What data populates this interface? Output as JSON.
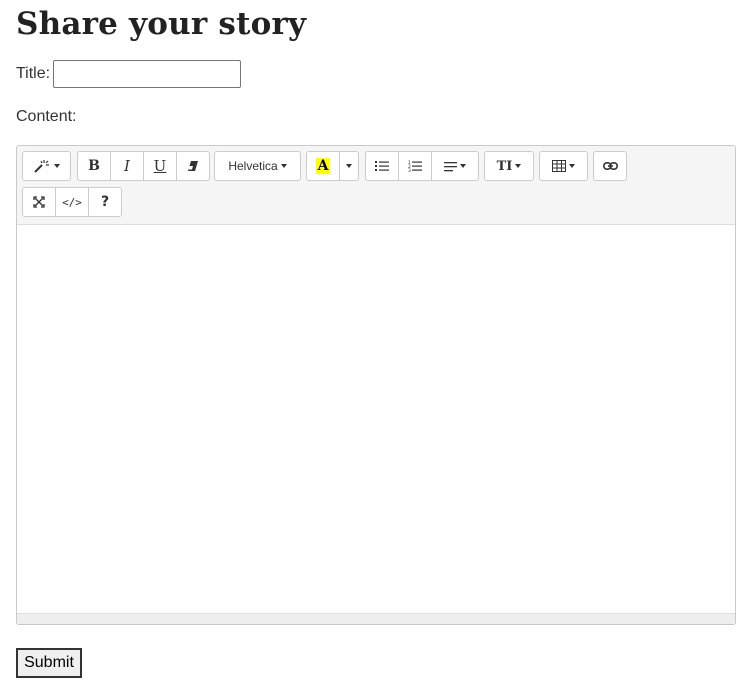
{
  "page": {
    "heading": "Share your story"
  },
  "form": {
    "title_label": "Title:",
    "title_value": "",
    "content_label": "Content:",
    "submit_label": "Submit"
  },
  "toolbar": {
    "font_name": "Helvetica",
    "highlight_letter": "A",
    "font_size_glyph": "TI",
    "code_view_label": "</>",
    "help_label": "?",
    "highlight_color": "#ffff00",
    "icons": [
      "magic-wand-icon",
      "bold-icon",
      "italic-icon",
      "underline-icon",
      "eraser-icon",
      "unordered-list-icon",
      "ordered-list-icon",
      "align-icon",
      "table-icon",
      "link-icon",
      "fullscreen-icon",
      "code-view-icon",
      "help-icon"
    ]
  },
  "editor": {
    "content": ""
  }
}
